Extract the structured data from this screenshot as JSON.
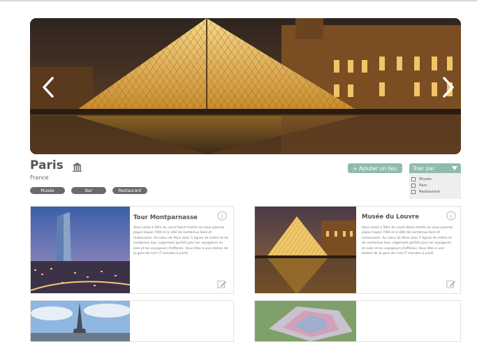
{
  "city": {
    "name": "Paris",
    "country": "France",
    "tags": [
      "Musée",
      "Bar",
      "Restaurant"
    ]
  },
  "actions": {
    "add_label": "+ Ajouter un lieu",
    "sort_label": "Trier par",
    "sort_options": [
      "Musée",
      "Parc",
      "Restaurant"
    ]
  },
  "cards": [
    {
      "title": "Tour Montparnasse",
      "description": "Vous serez à 50m du canal Saint-martin où vous pourrez pique-niquer l'été et à côté de nombreux bars et restaurants. Au cœur de Paris avec 5 lignes de métro et de nombreux bus. Logement parfait pour les voyageurs en solo et les voyageurs d'affaires. Vous êtes à une station de la gare de l'est (7 minutes à pied)."
    },
    {
      "title": "Musée du Louvre",
      "description": "Vous serez à 50m du canal Saint-martin où vous pourrez pique-niquer l'été et à côté de nombreux bars et restaurants. Au cœur de Paris avec 5 lignes de métro et de nombreux bus. Logement parfait pour les voyageurs en solo et les voyageurs d'affaires. Vous êtes à une station de la gare de l'est (7 minutes à pied)."
    }
  ],
  "colors": {
    "accent": "#8fbcad",
    "tag": "#6a6a6a"
  },
  "icons": {
    "prev": "chevron-left-icon",
    "next": "chevron-right-icon",
    "category": "monument-icon",
    "info": "info-icon",
    "edit": "edit-icon"
  }
}
